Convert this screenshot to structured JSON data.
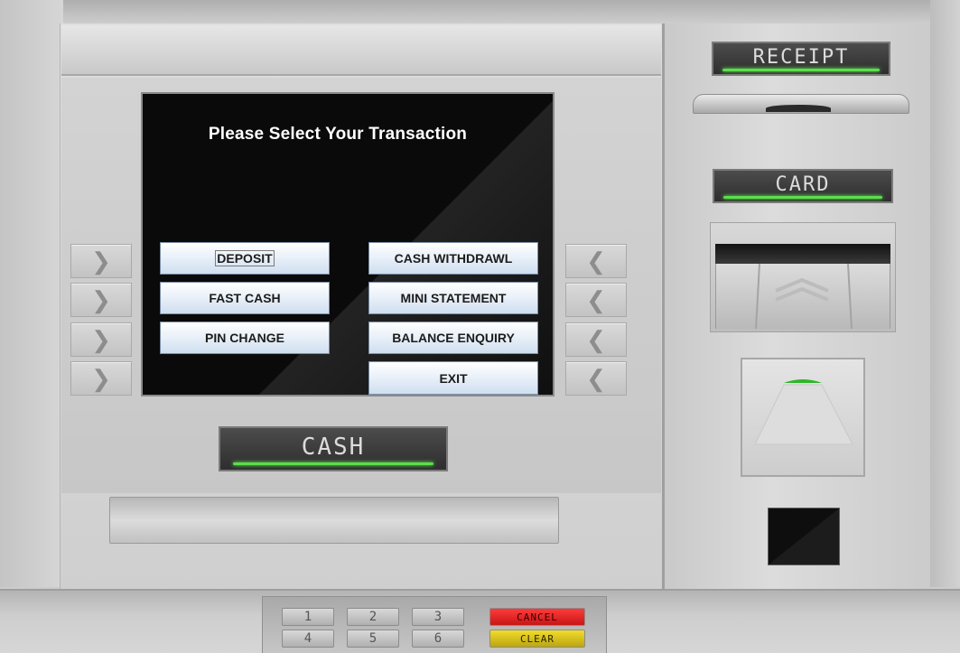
{
  "screen": {
    "title": "Please Select Your Transaction",
    "buttons": {
      "deposit": "DEPOSIT",
      "cash_withdrawl": "CASH WITHDRAWL",
      "fast_cash": "FAST CASH",
      "mini_statement": "MINI STATEMENT",
      "pin_change": "PIN CHANGE",
      "balance_enquiry": "BALANCE ENQUIRY",
      "exit": "EXIT"
    }
  },
  "side_keys": {
    "left_glyph": "❯",
    "right_glyph": "❮"
  },
  "labels": {
    "receipt": "RECEIPT",
    "card": "CARD",
    "cash": "CASH"
  },
  "keypad": {
    "row1": [
      "1",
      "2",
      "3"
    ],
    "row2": [
      "4",
      "5",
      "6"
    ],
    "cancel": "CANCEL",
    "clear": "CLEAR"
  },
  "colors": {
    "indicator_green": "#59e04a",
    "cancel_red": "#e02020",
    "clear_yellow": "#d8c21c",
    "button_text": "#1c1c1c"
  }
}
